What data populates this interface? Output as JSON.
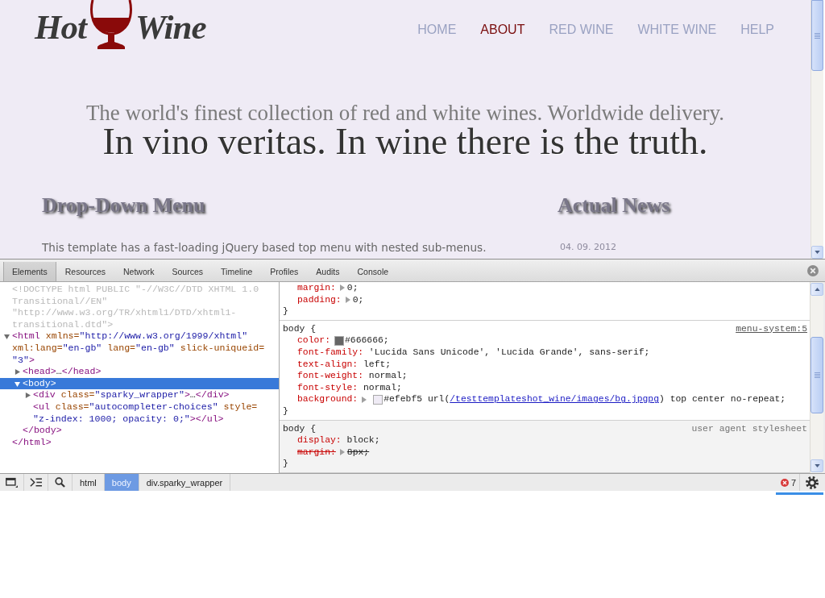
{
  "site": {
    "logo": {
      "left": "Hot",
      "right": "Wine"
    },
    "nav": [
      {
        "label": "HOME",
        "selected": false
      },
      {
        "label": "ABOUT",
        "selected": true
      },
      {
        "label": "RED WINE",
        "selected": false
      },
      {
        "label": "WHITE WINE",
        "selected": false
      },
      {
        "label": "HELP",
        "selected": false
      }
    ],
    "tagline": "The world's finest collection of red and white wines. Worldwide delivery.",
    "headline": "In vino veritas. In wine there is the truth.",
    "sections": [
      {
        "heading": "Drop-Down Menu",
        "text": "This template has a fast-loading jQuery based top menu with nested sub-menus."
      },
      {
        "heading": "Actual News",
        "date": "04. 09. 2012"
      }
    ]
  },
  "devtools": {
    "tabs": [
      {
        "label": "Elements",
        "selected": true
      },
      {
        "label": "Resources",
        "selected": false
      },
      {
        "label": "Network",
        "selected": false
      },
      {
        "label": "Sources",
        "selected": false
      },
      {
        "label": "Timeline",
        "selected": false
      },
      {
        "label": "Profiles",
        "selected": false
      },
      {
        "label": "Audits",
        "selected": false
      },
      {
        "label": "Console",
        "selected": false
      }
    ],
    "dom_tree": [
      {
        "kind": "doctype",
        "selected": false,
        "text": "<!DOCTYPE html PUBLIC \"-//W3C//DTD XHTML 1.0 Transitional//EN\" \"http://www.w3.org/TR/xhtml1/DTD/xhtml1-transitional.dtd\">"
      },
      {
        "kind": "container",
        "expanded": true,
        "selected": false,
        "open": [
          {
            "kind": "tag",
            "text": "<html"
          },
          {
            "kind": "attr",
            "text": " xmlns="
          },
          {
            "kind": "value",
            "text": "\"http://www.w3.org/1999/xhtml\""
          },
          {
            "kind": "attr",
            "text": " xml:lang="
          },
          {
            "kind": "value",
            "text": "\"en-gb\""
          },
          {
            "kind": "attr",
            "text": " lang="
          },
          {
            "kind": "value",
            "text": "\"en-gb\""
          },
          {
            "kind": "attr",
            "text": " slick-uniqueid="
          },
          {
            "kind": "value",
            "text": "\"3\""
          },
          {
            "kind": "tag",
            "text": ">"
          }
        ],
        "close": [
          {
            "kind": "tag",
            "text": "</html>"
          }
        ],
        "children": [
          {
            "kind": "container",
            "expanded": false,
            "selected": false,
            "open": [
              {
                "kind": "tag",
                "text": "<head>"
              }
            ],
            "ellipsis": "…",
            "close": [
              {
                "kind": "tag",
                "text": "</head>"
              }
            ]
          },
          {
            "kind": "container",
            "expanded": true,
            "selected": true,
            "open": [
              {
                "kind": "tag",
                "text": "<body>"
              }
            ],
            "close": [
              {
                "kind": "tag",
                "text": "</body>"
              }
            ],
            "children": [
              {
                "kind": "container",
                "expanded": false,
                "selected": false,
                "open": [
                  {
                    "kind": "tag",
                    "text": "<div"
                  },
                  {
                    "kind": "attr",
                    "text": " class="
                  },
                  {
                    "kind": "value",
                    "text": "\"sparky_wrapper\""
                  },
                  {
                    "kind": "tag",
                    "text": ">"
                  }
                ],
                "ellipsis": "…",
                "close": [
                  {
                    "kind": "tag",
                    "text": "</div>"
                  }
                ]
              },
              {
                "kind": "empty",
                "selected": false,
                "open": [
                  {
                    "kind": "tag",
                    "text": "<ul"
                  },
                  {
                    "kind": "attr",
                    "text": " class="
                  },
                  {
                    "kind": "value",
                    "text": "\"autocompleter-choices\""
                  },
                  {
                    "kind": "attr",
                    "text": " style="
                  },
                  {
                    "kind": "value",
                    "text": "\"z-index: 1000; opacity: 0;\""
                  },
                  {
                    "kind": "tag",
                    "text": ">"
                  }
                ],
                "close": [
                  {
                    "kind": "tag",
                    "text": "</ul>"
                  }
                ]
              }
            ]
          }
        ]
      }
    ],
    "styles": {
      "rules": [
        {
          "kind": "author",
          "properties": [
            {
              "name": "margin:",
              "expandable": true,
              "overridden": false,
              "value": "0;"
            },
            {
              "name": "padding:",
              "expandable": true,
              "overridden": false,
              "value": "0;"
            }
          ],
          "brace_close": "}"
        },
        {
          "kind": "author",
          "selector": "body {",
          "source": "menu-system:5",
          "properties": [
            {
              "name": "color:",
              "expandable": false,
              "overridden": false,
              "color": "#666666",
              "value": "#666666;"
            },
            {
              "name": "font-family:",
              "expandable": false,
              "overridden": false,
              "value": "'Lucida Sans Unicode', 'Lucida Grande', sans-serif;"
            },
            {
              "name": "text-align:",
              "expandable": false,
              "overridden": false,
              "value": "left;"
            },
            {
              "name": "font-weight:",
              "expandable": false,
              "overridden": false,
              "value": "normal;"
            },
            {
              "name": "font-style:",
              "expandable": false,
              "overridden": false,
              "value": "normal;"
            },
            {
              "name": "background:",
              "expandable": true,
              "overridden": false,
              "color": "#efebf5",
              "value": "#efebf5 url(",
              "link": "/testtemplateshot_wine/images/bg.jpgpg",
              "value_end": ") top center no-repeat;"
            }
          ],
          "brace_close": "}"
        },
        {
          "kind": "user-agent",
          "selector": "body {",
          "source": "user agent stylesheet",
          "properties": [
            {
              "name": "display:",
              "expandable": false,
              "overridden": false,
              "value": "block;"
            },
            {
              "name": "margin:",
              "expandable": true,
              "overridden": true,
              "value": "8px;"
            }
          ],
          "brace_close": "}"
        }
      ]
    },
    "breadcrumbs": [
      {
        "label": "html",
        "selected": false
      },
      {
        "label": "body",
        "selected": true
      },
      {
        "label": "div.sparky_wrapper",
        "selected": false
      }
    ],
    "error_count": "7"
  }
}
